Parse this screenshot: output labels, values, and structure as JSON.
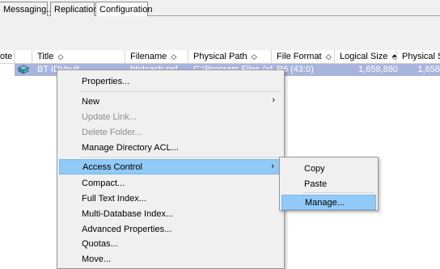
{
  "tabs": [
    "Messaging...",
    "Replication",
    "Configuration"
  ],
  "columns": [
    {
      "label": "ote",
      "sort": ""
    },
    {
      "label": "",
      "sort": ""
    },
    {
      "label": "Title",
      "sort": "◇"
    },
    {
      "label": "Filename",
      "sort": "◇"
    },
    {
      "label": "Physical Path",
      "sort": "◇"
    },
    {
      "label": "File Format",
      "sort": "◇"
    },
    {
      "label": "Logical Size",
      "sort": "⬘"
    },
    {
      "label": "Physical Siz",
      "sort": ""
    }
  ],
  "row": {
    "icon": "database-icon",
    "title": "BT IDVault",
    "filename": "btidcach.nsf",
    "physical_path": "C:\\Program Files (x86",
    "file_format": "R6 (43:0)",
    "logical_size": "1,658,880",
    "physical_size": "1,658"
  },
  "context_menu": {
    "items": [
      {
        "label": "Properties...",
        "enabled": true
      },
      {
        "label": "New",
        "enabled": true,
        "submenu": true
      },
      {
        "label": "Update Link...",
        "enabled": false
      },
      {
        "label": "Delete Folder...",
        "enabled": false
      },
      {
        "label": "Manage Directory ACL...",
        "enabled": true
      },
      {
        "label": "Access Control",
        "enabled": true,
        "submenu": true,
        "highlighted": true
      },
      {
        "label": "Compact...",
        "enabled": true
      },
      {
        "label": "Full Text Index...",
        "enabled": true
      },
      {
        "label": "Multi-Database Index...",
        "enabled": true
      },
      {
        "label": "Advanced Properties...",
        "enabled": true
      },
      {
        "label": "Quotas...",
        "enabled": true
      },
      {
        "label": "Move...",
        "enabled": true
      }
    ],
    "submenu_arrow": "›"
  },
  "access_control_submenu": {
    "items": [
      {
        "label": "Copy"
      },
      {
        "label": "Paste"
      },
      {
        "label": "Manage...",
        "highlighted": true
      }
    ]
  },
  "colors": {
    "selection": "#a8b4dd",
    "menu_highlight": "#91c9f7",
    "menu_bg": "#f0f0f0"
  }
}
